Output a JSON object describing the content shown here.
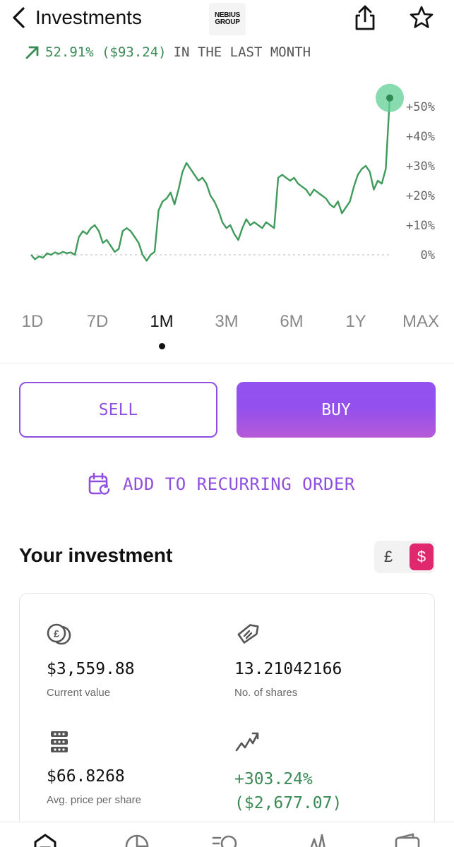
{
  "header": {
    "title": "Investments",
    "logo_line1": "NEBIUS",
    "logo_line2": "GROUP"
  },
  "performance": {
    "value": "52.91% ($93.24)",
    "suffix": "IN THE LAST MONTH",
    "color": "#3a8a55"
  },
  "chart_data": {
    "type": "line",
    "y_tick_labels": [
      "+50%",
      "+40%",
      "+30%",
      "+20%",
      "+10%",
      "0%"
    ],
    "ylim": [
      -3,
      55
    ],
    "baseline": 0,
    "series": [
      {
        "values": [
          0,
          -1.5,
          -0.5,
          -1,
          0.5,
          0,
          0.8,
          0.3,
          1,
          0.5,
          0.8,
          0,
          6,
          8,
          7,
          9,
          10,
          8,
          4,
          5,
          3,
          1,
          2,
          8,
          9,
          8,
          6,
          4,
          0,
          -2,
          0,
          1,
          15,
          18,
          19,
          21,
          17,
          22,
          28,
          31,
          29,
          27,
          25,
          26,
          24,
          20,
          18,
          15,
          11,
          9,
          10,
          7,
          5,
          9,
          12,
          10,
          11,
          10,
          9,
          11,
          10,
          9,
          26,
          27,
          26,
          25,
          26,
          24,
          23,
          22,
          20,
          22,
          21,
          20,
          19,
          17,
          16,
          18,
          14,
          16,
          18,
          23,
          27,
          29,
          30,
          28,
          22,
          25,
          24,
          29,
          52.91
        ],
        "color": "#3f9a5c"
      }
    ],
    "time_ranges": [
      "1D",
      "7D",
      "1M",
      "3M",
      "6M",
      "1Y",
      "MAX"
    ],
    "selected_range": "1M"
  },
  "actions": {
    "sell_label": "SELL",
    "buy_label": "BUY",
    "recurring_label": "ADD TO RECURRING ORDER",
    "accent": "#8f4fe0"
  },
  "investment": {
    "title": "Your investment",
    "currency_gbp": "£",
    "currency_usd": "$",
    "currency_selected": "$",
    "current_value": "$3,559.88",
    "current_value_label": "Current value",
    "shares": "13.21042166",
    "shares_label": "No. of shares",
    "avg_price": "$66.8268",
    "avg_price_label": "Avg. price per share",
    "return_pct": "+303.24%",
    "return_amount": "($2,677.07)"
  },
  "icons": {
    "back": "chevron-left-icon",
    "share": "share-icon",
    "star": "star-icon",
    "calendar": "calendar-repeat-icon",
    "coins": "coins-icon",
    "tag": "tag-icon",
    "stack": "stack-icon",
    "trend": "trend-icon"
  },
  "tabbar": {
    "items": [
      "home",
      "portfolio",
      "explore",
      "activity",
      "wallet"
    ],
    "selected": "home"
  }
}
